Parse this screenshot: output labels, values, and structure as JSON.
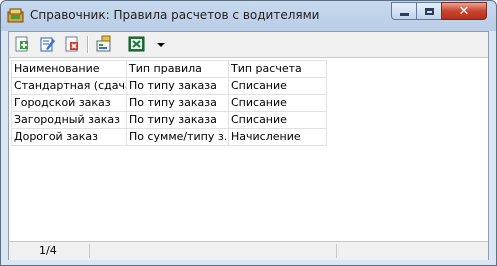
{
  "window": {
    "title": "Справочник: Правила расчетов с водителями",
    "close_glyph": "✕"
  },
  "toolbar": {
    "icons": [
      "add-icon",
      "edit-icon",
      "delete-icon",
      "properties-icon",
      "excel-export-icon",
      "dropdown-arrow-icon"
    ]
  },
  "table": {
    "headers": [
      "Наименование",
      "Тип правила",
      "Тип расчета"
    ],
    "rows": [
      [
        "Стандартная (сдача)",
        "По типу заказа",
        "Списание"
      ],
      [
        "Городской заказ",
        "По типу заказа",
        "Списание"
      ],
      [
        "Загородный заказ",
        "По типу заказа",
        "Списание"
      ],
      [
        "Дорогой заказ",
        "По сумме/типу з...",
        "Начисление"
      ]
    ]
  },
  "status": {
    "count": "1/4"
  },
  "colors": {
    "title_bg": "#c7d9ee",
    "close_btn": "#c8442d",
    "grid_line": "#e1e1e1"
  }
}
